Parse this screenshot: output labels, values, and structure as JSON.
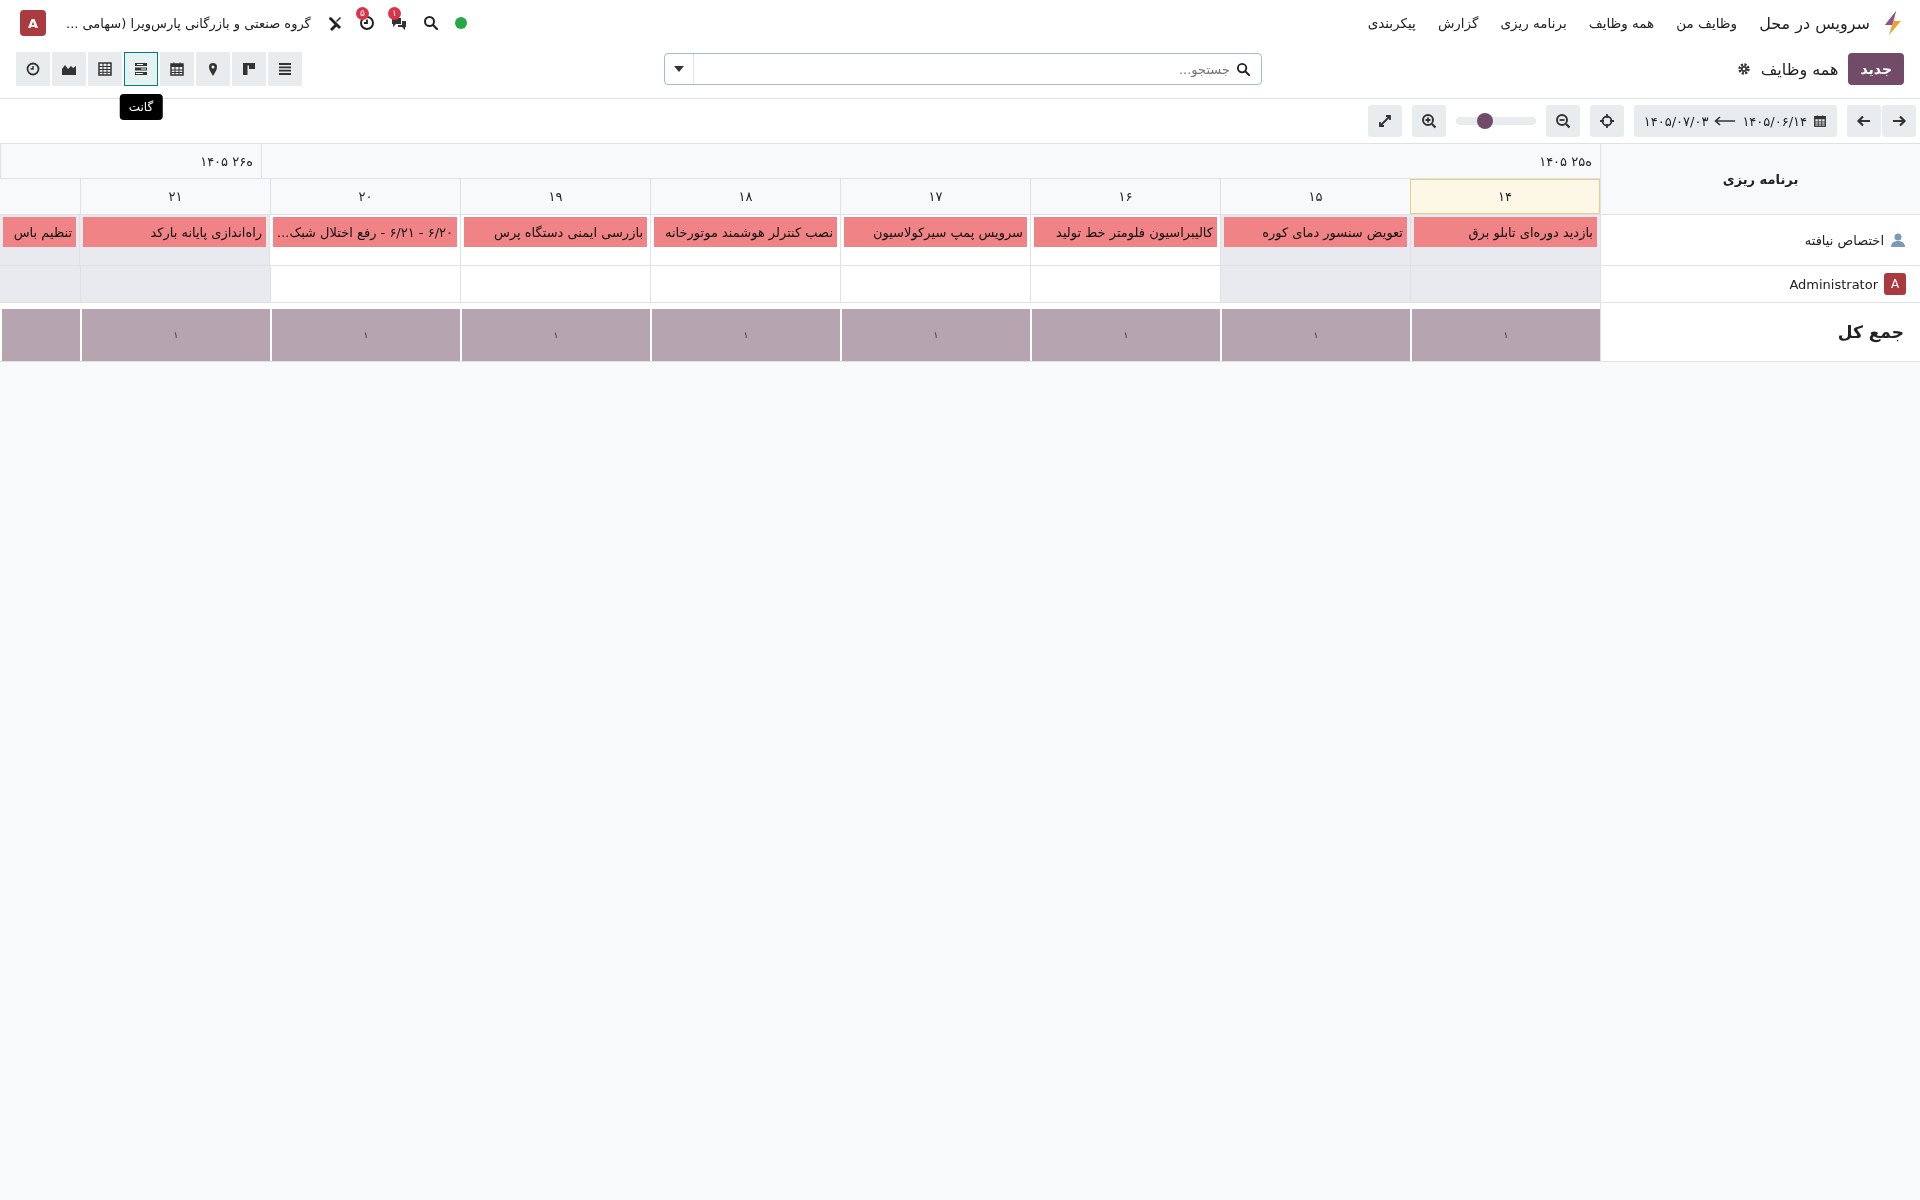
{
  "navbar": {
    "app_name": "سرویس در محل",
    "menu": [
      "وظایف من",
      "همه وظایف",
      "برنامه ریزی",
      "گزارش",
      "پیکربندی"
    ],
    "systray": [
      {
        "kind": "status"
      },
      {
        "kind": "search"
      },
      {
        "kind": "chat",
        "badge": "۱"
      },
      {
        "kind": "activity",
        "badge": "۵"
      },
      {
        "kind": "tools"
      }
    ],
    "company": "گروه صنعتی و بازرگانی پارس‌ویرا (سهامی ...",
    "avatar": "A"
  },
  "control_panel": {
    "new_button": "جدید",
    "title": "همه وظایف",
    "search": {
      "placeholder": "جستجو..."
    },
    "views": [
      {
        "kind": "list",
        "selected": false
      },
      {
        "kind": "kanban",
        "selected": false
      },
      {
        "kind": "map",
        "selected": false
      },
      {
        "kind": "calendar",
        "selected": false
      },
      {
        "kind": "gantt",
        "selected": true,
        "tooltip": "گانت"
      },
      {
        "kind": "pivot",
        "selected": false
      },
      {
        "kind": "graph",
        "selected": false
      },
      {
        "kind": "activity",
        "selected": false
      }
    ]
  },
  "gantt_toolbar": {
    "range_start": "۱۴۰۵/۰۶/۱۴",
    "range_end": "۱۴۰۵/۰۷/۰۳",
    "zoom": {
      "level": 0.37
    }
  },
  "gantt": {
    "title": "برنامه ریزی",
    "weeks": [
      {
        "label": "۱۴۰۵ ۲۵ه",
        "days": [
          {
            "label": "۱۴",
            "today": true,
            "unavailable": true
          },
          {
            "label": "۱۵",
            "today": false,
            "unavailable": true
          },
          {
            "label": "۱۶",
            "today": false,
            "unavailable": false
          },
          {
            "label": "۱۷",
            "today": false,
            "unavailable": false
          },
          {
            "label": "۱۸",
            "today": false,
            "unavailable": false
          },
          {
            "label": "۱۹",
            "today": false,
            "unavailable": false
          },
          {
            "label": "۲۰",
            "today": false,
            "unavailable": false
          }
        ]
      },
      {
        "label": "۱۴۰۵ ۲۶ه",
        "days": [
          {
            "label": "۲۱",
            "today": false,
            "unavailable": true
          },
          {
            "today": false,
            "unavailable": true
          }
        ]
      }
    ],
    "rows": [
      {
        "kind": "unassigned",
        "name": "اختصاص نیافته",
        "tasks": [
          "بازدید دوره‌ای تابلو برق",
          "تعویض سنسور دمای کوره",
          "کالیبراسیون فلومتر خط تولید",
          "سرویس پمپ سیرکولاسیون",
          "نصب کنترلر هوشمند موتورخانه",
          "بازرسی ایمنی دستگاه پرس",
          "۶/۲۰ - ۶/۲۱ - رفع اختلال شبک...",
          "راه‌اندازی پایانه بارکد",
          "تنظیم باس"
        ]
      },
      {
        "kind": "user",
        "name": "Administrator",
        "avatar": "A",
        "tasks": []
      }
    ],
    "totals": {
      "label": "جمع کل",
      "values": [
        "۱",
        "۱",
        "۱",
        "۱",
        "۱",
        "۱",
        "۱",
        "۱"
      ]
    }
  }
}
